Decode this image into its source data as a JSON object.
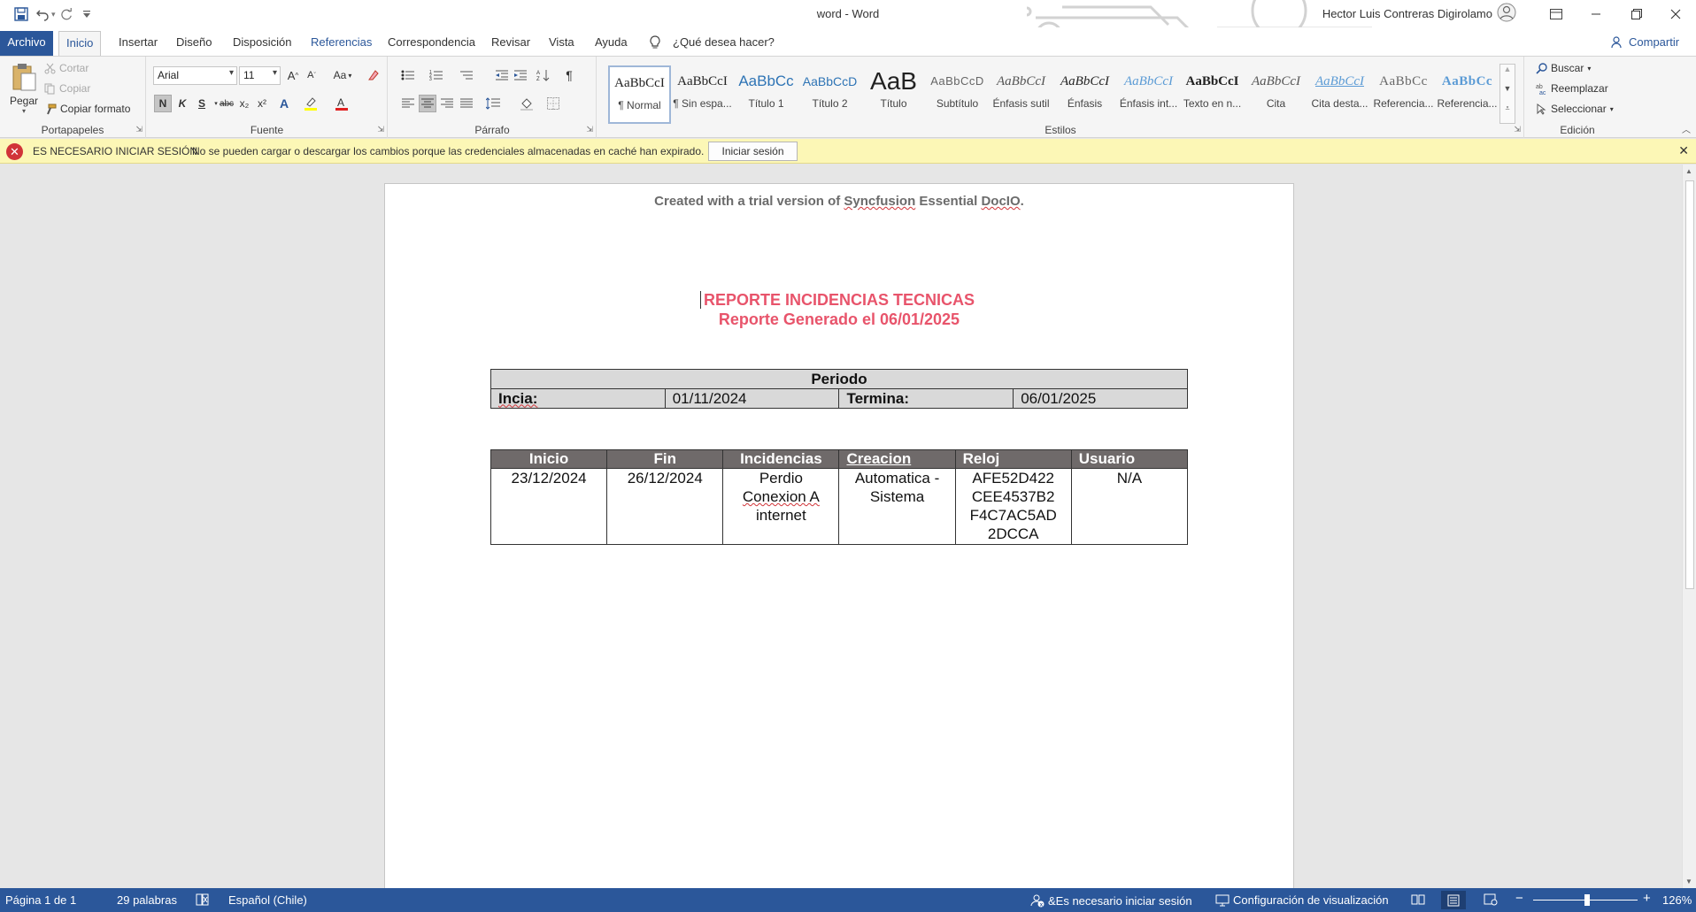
{
  "window": {
    "doc_name": "word",
    "app_name": "Word",
    "title_sep": " - ",
    "user": "Hector Luis Contreras Digirolamo"
  },
  "tabs": [
    {
      "label": "Archivo"
    },
    {
      "label": "Inicio"
    },
    {
      "label": "Insertar"
    },
    {
      "label": "Diseño"
    },
    {
      "label": "Disposición"
    },
    {
      "label": "Referencias"
    },
    {
      "label": "Correspondencia"
    },
    {
      "label": "Revisar"
    },
    {
      "label": "Vista"
    },
    {
      "label": "Ayuda"
    }
  ],
  "tell_me": "¿Qué desea hacer?",
  "share": "Compartir",
  "ribbon": {
    "clipboard": {
      "paste": "Pegar",
      "cut": "Cortar",
      "copy": "Copiar",
      "format_painter": "Copiar formato",
      "label": "Portapapeles"
    },
    "font": {
      "name": "Arial",
      "size": "11",
      "bold": "N",
      "italic": "K",
      "underline": "S",
      "strike": "abc",
      "sub": "x₂",
      "sup": "x²",
      "case": "Aa",
      "label": "Fuente"
    },
    "paragraph": {
      "label": "Párrafo"
    },
    "styles": {
      "label": "Estilos",
      "items": [
        {
          "preview": "AaBbCcI",
          "name": "¶ Normal"
        },
        {
          "preview": "AaBbCcI",
          "name": "¶ Sin espa..."
        },
        {
          "preview": "AaBbCc",
          "name": "Título 1"
        },
        {
          "preview": "AaBbCcD",
          "name": "Título 2"
        },
        {
          "preview": "AaB",
          "name": "Título"
        },
        {
          "preview": "AaBbCcD",
          "name": "Subtítulo"
        },
        {
          "preview": "AaBbCcI",
          "name": "Énfasis sutil"
        },
        {
          "preview": "AaBbCcI",
          "name": "Énfasis"
        },
        {
          "preview": "AaBbCcI",
          "name": "Énfasis int..."
        },
        {
          "preview": "AaBbCcI",
          "name": "Texto en n..."
        },
        {
          "preview": "AaBbCcI",
          "name": "Cita"
        },
        {
          "preview": "AaBbCcI",
          "name": "Cita desta..."
        },
        {
          "preview": "AaBbCc",
          "name": "Referencia..."
        },
        {
          "preview": "AaBbCc",
          "name": "Referencia..."
        }
      ]
    },
    "editing": {
      "find": "Buscar",
      "replace": "Reemplazar",
      "select": "Seleccionar",
      "label": "Edición"
    }
  },
  "message_bar": {
    "title": "ES NECESARIO INICIAR SESIÓN",
    "text": "No se pueden cargar o descargar los cambios porque las credenciales almacenadas en caché han expirado.",
    "button": "Iniciar sesión"
  },
  "document": {
    "trial_prefix": "Created with a trial version of ",
    "trial_word1": "Syncfusion",
    "trial_mid": " Essential ",
    "trial_word2": "DocIO",
    "trial_end": ".",
    "title": "REPORTE INCIDENCIAS TECNICAS",
    "subtitle": "Reporte Generado el 06/01/2025",
    "period": {
      "header": "Periodo",
      "start_label": "Incia:",
      "start_value": "01/11/2024",
      "end_label": "Termina:",
      "end_value": "06/01/2025"
    },
    "incidents": {
      "headers": [
        "Inicio",
        "Fin",
        "Incidencias",
        "Creacion",
        "Reloj",
        "Usuario"
      ],
      "rows": [
        {
          "inicio": "23/12/2024",
          "fin": "26/12/2024",
          "incidencia_1": "Perdio",
          "incidencia_2": "Conexion A",
          "incidencia_3": "internet",
          "creacion_1": "Automatica -",
          "creacion_2": "Sistema",
          "reloj_1": "AFE52D422",
          "reloj_2": "CEE4537B2",
          "reloj_3": "F4C7AC5AD",
          "reloj_4": "2DCCA",
          "usuario": "N/A"
        }
      ]
    }
  },
  "status": {
    "page": "Página 1 de 1",
    "words": "29 palabras",
    "language": "Español (Chile)",
    "signin": "&Es necesario iniciar sesión",
    "display": "Configuración de visualización",
    "zoom": "126%",
    "zoom_fraction": 0.52
  },
  "colors": {
    "accent": "#2b579a",
    "report_title": "#e8546b",
    "message_bar": "#fcf7b6",
    "error": "#d13438",
    "table_header": "#6f6a6a",
    "period_bg": "#d9d9d9"
  }
}
